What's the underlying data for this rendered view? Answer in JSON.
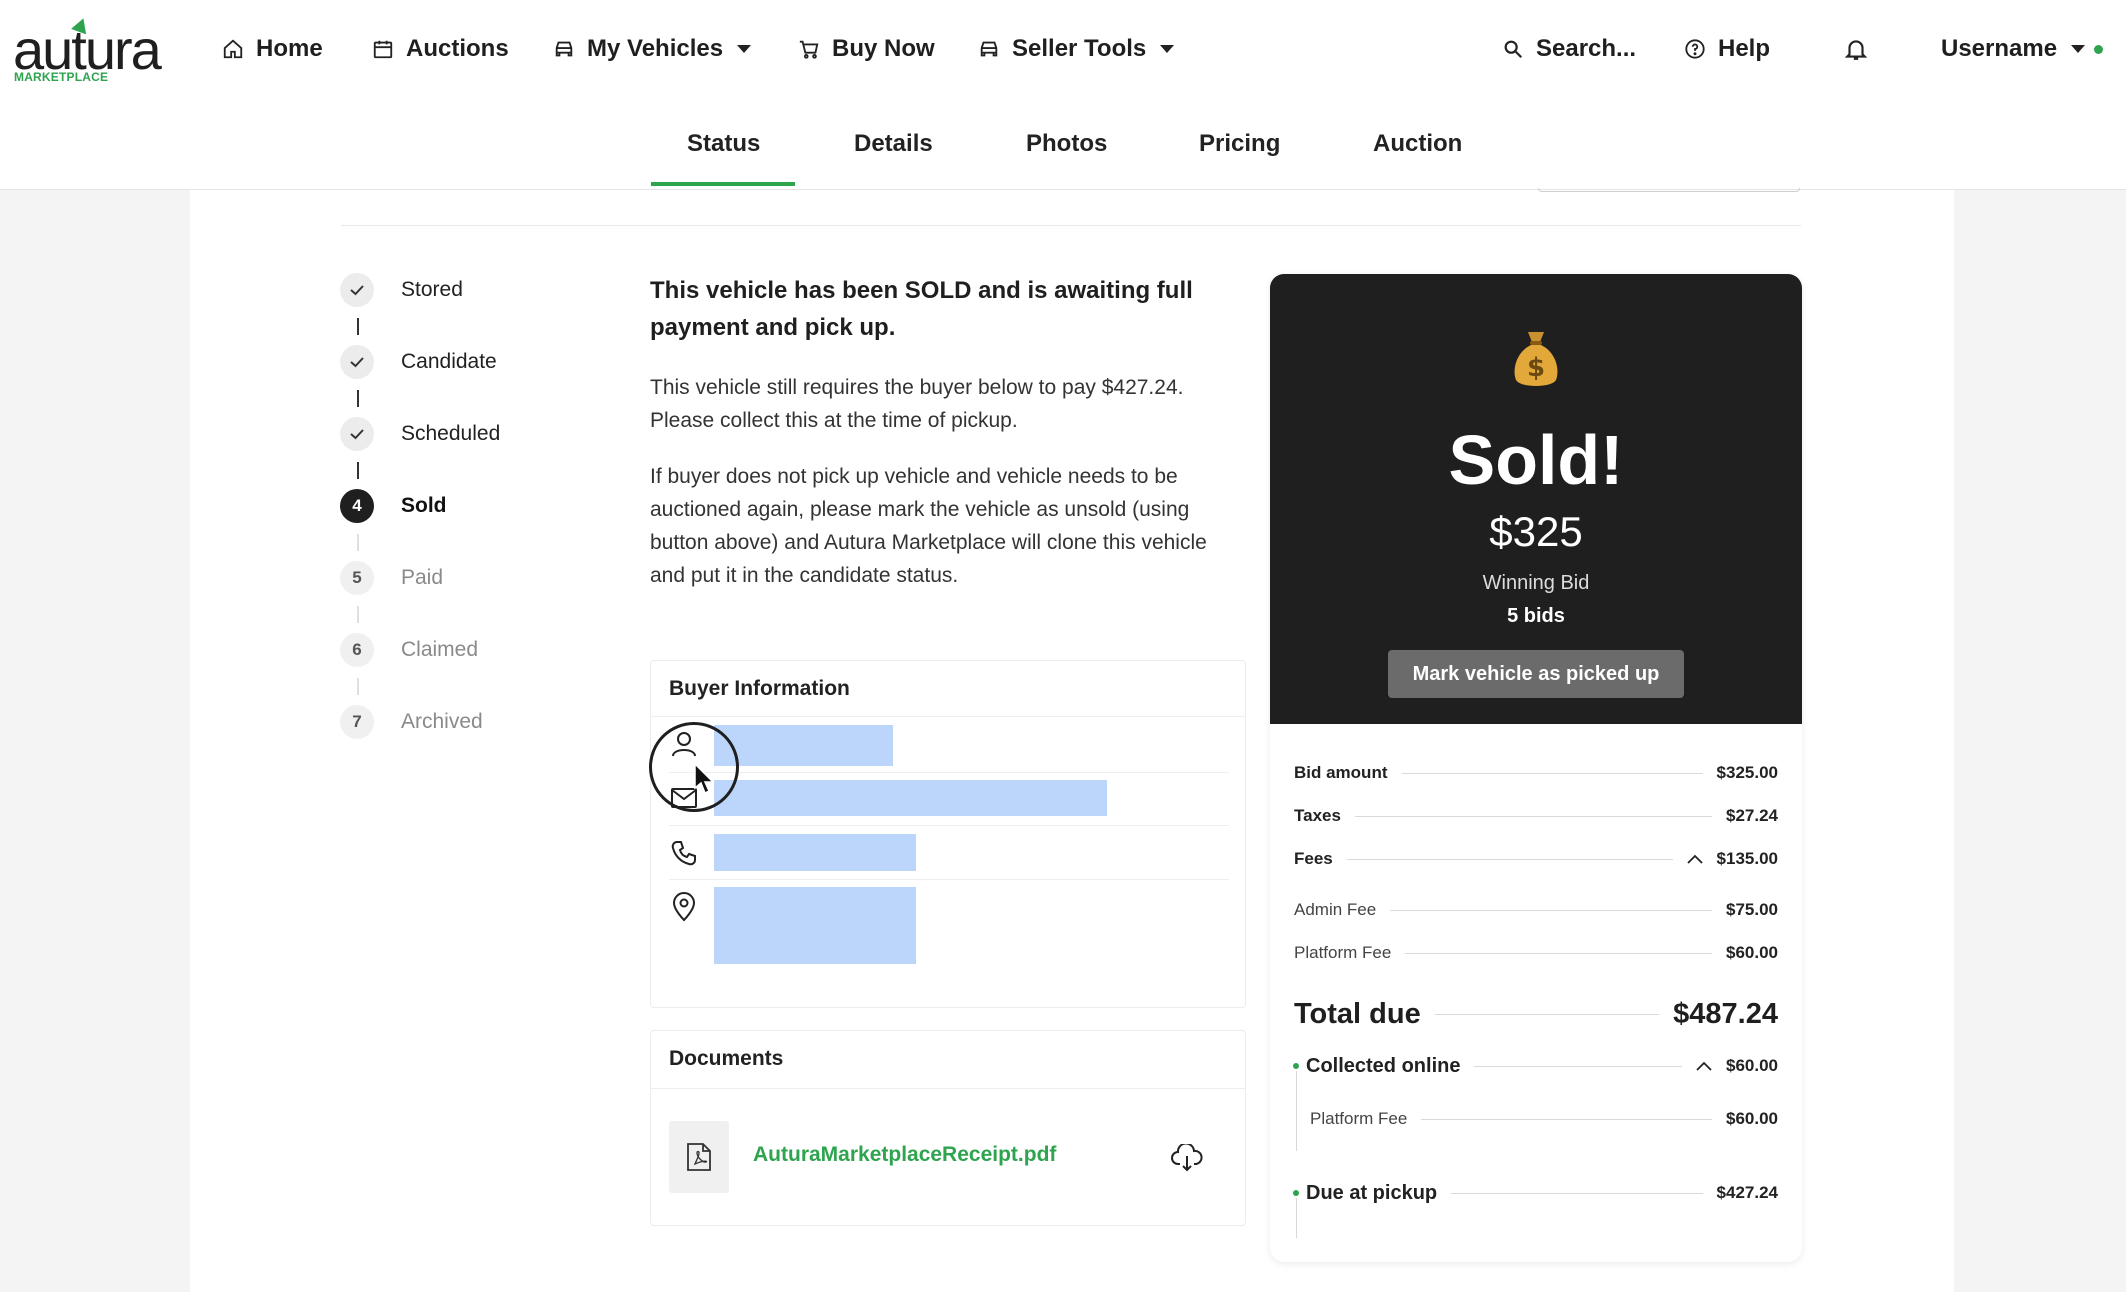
{
  "brand": {
    "name": "autura",
    "sub": "MARKETPLACE"
  },
  "nav": {
    "home": "Home",
    "auctions": "Auctions",
    "my_vehicles": "My Vehicles",
    "buy_now": "Buy Now",
    "seller_tools": "Seller Tools",
    "search": "Search...",
    "help": "Help",
    "username": "Username"
  },
  "tabs": [
    "Status",
    "Details",
    "Photos",
    "Pricing",
    "Auction"
  ],
  "active_tab": "Status",
  "stepper": [
    {
      "num": "1",
      "label": "Stored",
      "state": "done"
    },
    {
      "num": "2",
      "label": "Candidate",
      "state": "done"
    },
    {
      "num": "3",
      "label": "Scheduled",
      "state": "done"
    },
    {
      "num": "4",
      "label": "Sold",
      "state": "current"
    },
    {
      "num": "5",
      "label": "Paid",
      "state": "todo"
    },
    {
      "num": "6",
      "label": "Claimed",
      "state": "todo"
    },
    {
      "num": "7",
      "label": "Archived",
      "state": "todo"
    }
  ],
  "status": {
    "heading": "This vehicle has been SOLD and is awaiting full payment and pick up.",
    "para1": "This vehicle still requires the buyer below to pay $427.24. Please collect this at the time of pickup.",
    "para2": "If buyer does not pick up vehicle and vehicle needs to be auctioned again, please mark the vehicle as unsold (using button above) and Autura Marketplace will clone this vehicle and put it in the candidate status."
  },
  "buyer": {
    "title": "Buyer Information",
    "rows": [
      {
        "icon": "user-icon"
      },
      {
        "icon": "mail-icon"
      },
      {
        "icon": "phone-icon"
      },
      {
        "icon": "location-pin-icon"
      }
    ]
  },
  "documents": {
    "title": "Documents",
    "file_name": "AuturaMarketplaceReceipt.pdf"
  },
  "sold": {
    "title": "Sold!",
    "price": "$325",
    "winning_label": "Winning Bid",
    "bids": "5 bids",
    "button": "Mark vehicle as picked up",
    "breakdown": {
      "bid_amount": {
        "label": "Bid amount",
        "value": "$325.00"
      },
      "taxes": {
        "label": "Taxes",
        "value": "$27.24"
      },
      "fees": {
        "label": "Fees",
        "value": "$135.00"
      },
      "admin_fee": {
        "label": "Admin Fee",
        "value": "$75.00"
      },
      "platform_fee": {
        "label": "Platform Fee",
        "value": "$60.00"
      },
      "total_due": {
        "label": "Total due",
        "value": "$487.24"
      },
      "collected_online": {
        "label": "Collected online",
        "value": "$60.00"
      },
      "collected_platform_fee": {
        "label": "Platform Fee",
        "value": "$60.00"
      },
      "due_at_pickup": {
        "label": "Due at pickup",
        "value": "$427.24"
      }
    }
  },
  "colors": {
    "accent": "#2ea44f",
    "dark_panel": "#1f1f1f",
    "redaction": "#bcd6fb"
  }
}
